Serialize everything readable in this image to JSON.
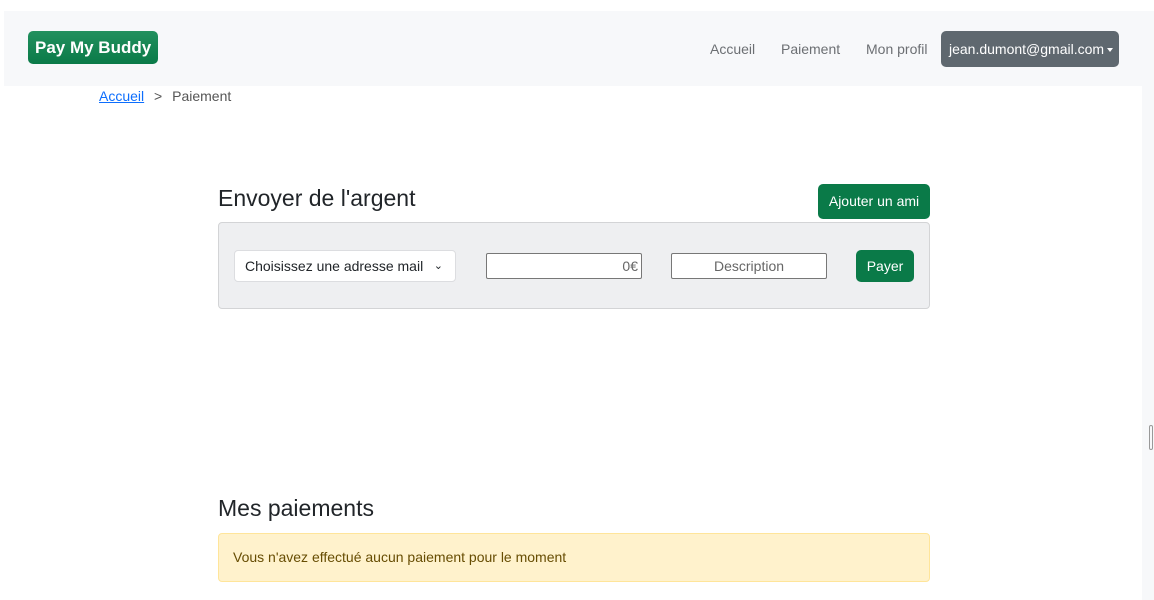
{
  "navbar": {
    "brand": "Pay My Buddy",
    "links": [
      "Accueil",
      "Paiement",
      "Mon profil"
    ],
    "user_email": "jean.dumont@gmail.com"
  },
  "breadcrumb": {
    "home": "Accueil",
    "separator": ">",
    "current": "Paiement"
  },
  "send": {
    "title": "Envoyer de l'argent",
    "add_friend_label": "Ajouter un ami",
    "select_placeholder": "Choisissez une adresse mail",
    "amount_placeholder": "0€",
    "description_placeholder": "Description",
    "pay_label": "Payer"
  },
  "payments": {
    "title": "Mes paiements",
    "empty_message": "Vous n'avez effectué aucun paiement pour le moment"
  }
}
